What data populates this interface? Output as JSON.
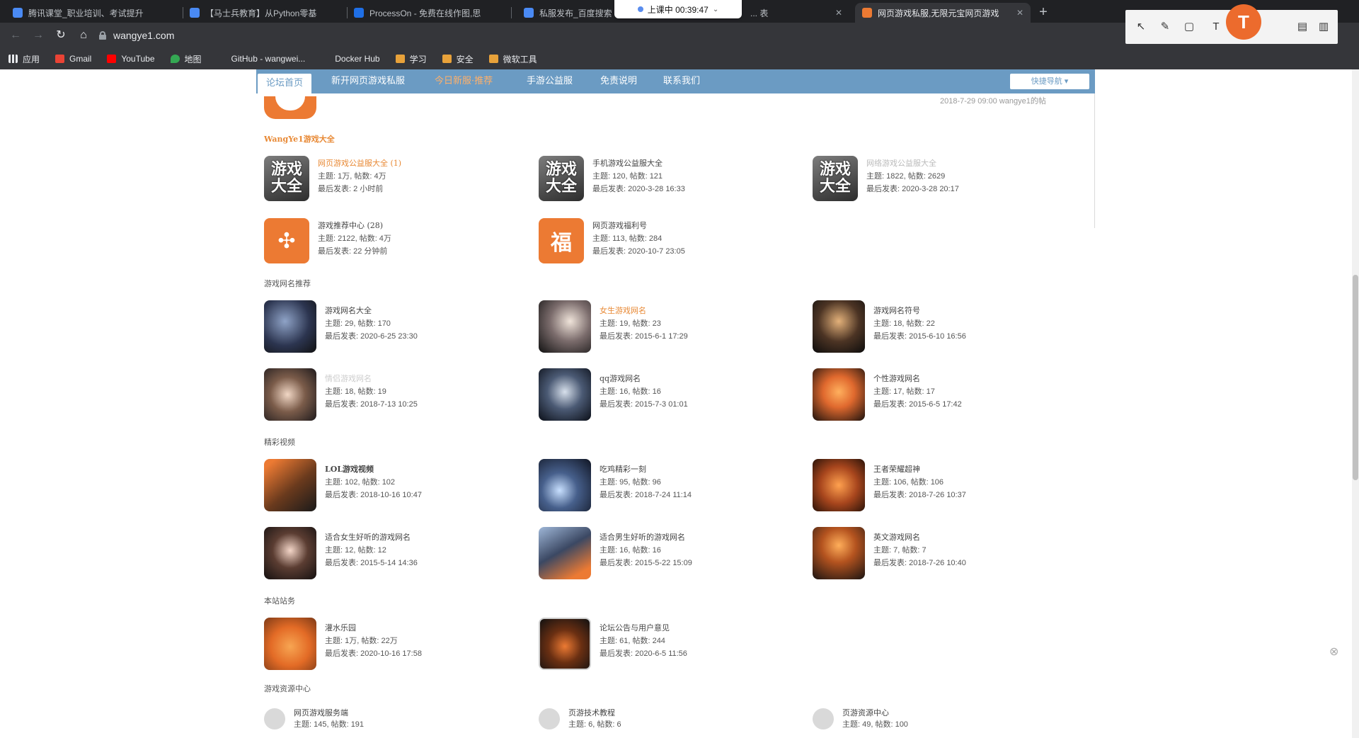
{
  "browser": {
    "tabs": [
      {
        "title": "腾讯课堂_职业培训、考试提升",
        "icon_color": "#4a8af4"
      },
      {
        "title": "【马士兵教育】从Python零基",
        "icon_color": "#4a8af4"
      },
      {
        "title": "ProcessOn - 免费在线作图,思",
        "icon_color": "#1f6fe6"
      },
      {
        "title": "私服发布_百度搜索",
        "icon_color": "#4a8af4"
      },
      {
        "title": "... 表",
        "icon_color": "#888888"
      },
      {
        "title": "网页游戏私服,无限元宝网页游戏",
        "icon_color": "#ec7a33"
      }
    ],
    "class_timer": "上课中 00:39:47",
    "url": "wangye1.com",
    "bookmarks": [
      {
        "label": "应用",
        "icon": "apps-grid-icon",
        "color": "#c5221f"
      },
      {
        "label": "Gmail",
        "icon": "gmail-icon",
        "color": "#ea4335"
      },
      {
        "label": "YouTube",
        "icon": "youtube-icon",
        "color": "#ff0000"
      },
      {
        "label": "地图",
        "icon": "maps-icon",
        "color": "#34a853"
      },
      {
        "label": "GitHub - wangwei...",
        "icon": "github-icon",
        "color": "#333333"
      },
      {
        "label": "Docker Hub",
        "icon": "docker-icon",
        "color": "#1d63ed"
      },
      {
        "label": "学习",
        "icon": "folder-icon",
        "color": "#e8a23a"
      },
      {
        "label": "安全",
        "icon": "folder-icon",
        "color": "#e8a23a"
      },
      {
        "label": "微软工具",
        "icon": "folder-icon",
        "color": "#e8a23a"
      }
    ]
  },
  "site": {
    "nav": {
      "items": [
        "论坛首页",
        "新开网页游戏私服",
        "今日新服·推荐",
        "手游公益服",
        "免责说明",
        "联系我们"
      ],
      "quick": "快捷导航 ▾"
    },
    "post_meta": "2018-7-29 09:00 wangye1的帖",
    "sections": [
      {
        "title": "WangYe1游戏大全",
        "forums": [
          {
            "name": "网页游戏公益服大全 (1)",
            "stats": "主题: 1万, 帖数: 4万",
            "last": "最后发表: 2 小时前"
          },
          {
            "name": "手机游戏公益服大全",
            "stats": "主题: 120, 帖数: 121",
            "last": "最后发表: 2020-3-28 16:33"
          },
          {
            "name": "网络游戏公益服大全",
            "stats": "主题: 1822, 帖数: 2629",
            "last": "最后发表: 2020-3-28 20:17"
          },
          {
            "name": "游戏推荐中心 (28)",
            "stats": "主题: 2122, 帖数: 4万",
            "last": "最后发表: 22 分钟前"
          },
          {
            "name": "网页游戏福利号",
            "stats": "主题: 113, 帖数: 284",
            "last": "最后发表: 2020-10-7 23:05"
          }
        ]
      },
      {
        "title": "游戏网名推荐",
        "forums": [
          {
            "name": "游戏网名大全",
            "stats": "主题: 29, 帖数: 170",
            "last": "最后发表: 2020-6-25 23:30"
          },
          {
            "name": "女生游戏网名",
            "stats": "主题: 19, 帖数: 23",
            "last": "最后发表: 2015-6-1 17:29"
          },
          {
            "name": "游戏网名符号",
            "stats": "主题: 18, 帖数: 22",
            "last": "最后发表: 2015-6-10 16:56"
          },
          {
            "name": "情侣游戏网名",
            "stats": "主题: 18, 帖数: 19",
            "last": "最后发表: 2018-7-13 10:25"
          },
          {
            "name": "qq游戏网名",
            "stats": "主题: 16, 帖数: 16",
            "last": "最后发表: 2015-7-3 01:01"
          },
          {
            "name": "个性游戏网名",
            "stats": "主题: 17, 帖数: 17",
            "last": "最后发表: 2015-6-5 17:42"
          }
        ]
      },
      {
        "title": "精彩视频",
        "forums": [
          {
            "name": "LOL游戏视频",
            "stats": "主题: 102, 帖数: 102",
            "last": "最后发表: 2018-10-16 10:47"
          },
          {
            "name": "吃鸡精彩一刻",
            "stats": "主题: 95, 帖数: 96",
            "last": "最后发表: 2018-7-24 11:14"
          },
          {
            "name": "王者荣耀超神",
            "stats": "主题: 106, 帖数: 106",
            "last": "最后发表: 2018-7-26 10:37"
          },
          {
            "name": "适合女生好听的游戏网名",
            "stats": "主题: 12, 帖数: 12",
            "last": "最后发表: 2015-5-14 14:36"
          },
          {
            "name": "适合男生好听的游戏网名",
            "stats": "主题: 16, 帖数: 16",
            "last": "最后发表: 2015-5-22 15:09"
          },
          {
            "name": "英文游戏网名",
            "stats": "主题: 7, 帖数: 7",
            "last": "最后发表: 2018-7-26 10:40"
          }
        ]
      },
      {
        "title": "本站站务",
        "forums": [
          {
            "name": "灌水乐园",
            "stats": "主题: 1万, 帖数: 22万",
            "last": "最后发表: 2020-10-16 17:58"
          },
          {
            "name": "论坛公告与用户意见",
            "stats": "主题: 61, 帖数: 244",
            "last": "最后发表: 2020-6-5 11:56"
          }
        ]
      },
      {
        "title": "游戏资源中心",
        "forums": [
          {
            "name": "网页游戏服务端",
            "stats": "主题: 145, 帖数: 191",
            "last": ""
          },
          {
            "name": "页游技术教程",
            "stats": "主题: 6, 帖数: 6",
            "last": ""
          },
          {
            "name": "页游资源中心",
            "stats": "主题: 49, 帖数: 100",
            "last": ""
          }
        ]
      }
    ],
    "icon_text": {
      "gd": "游戏\n大全",
      "fu": "福"
    }
  }
}
